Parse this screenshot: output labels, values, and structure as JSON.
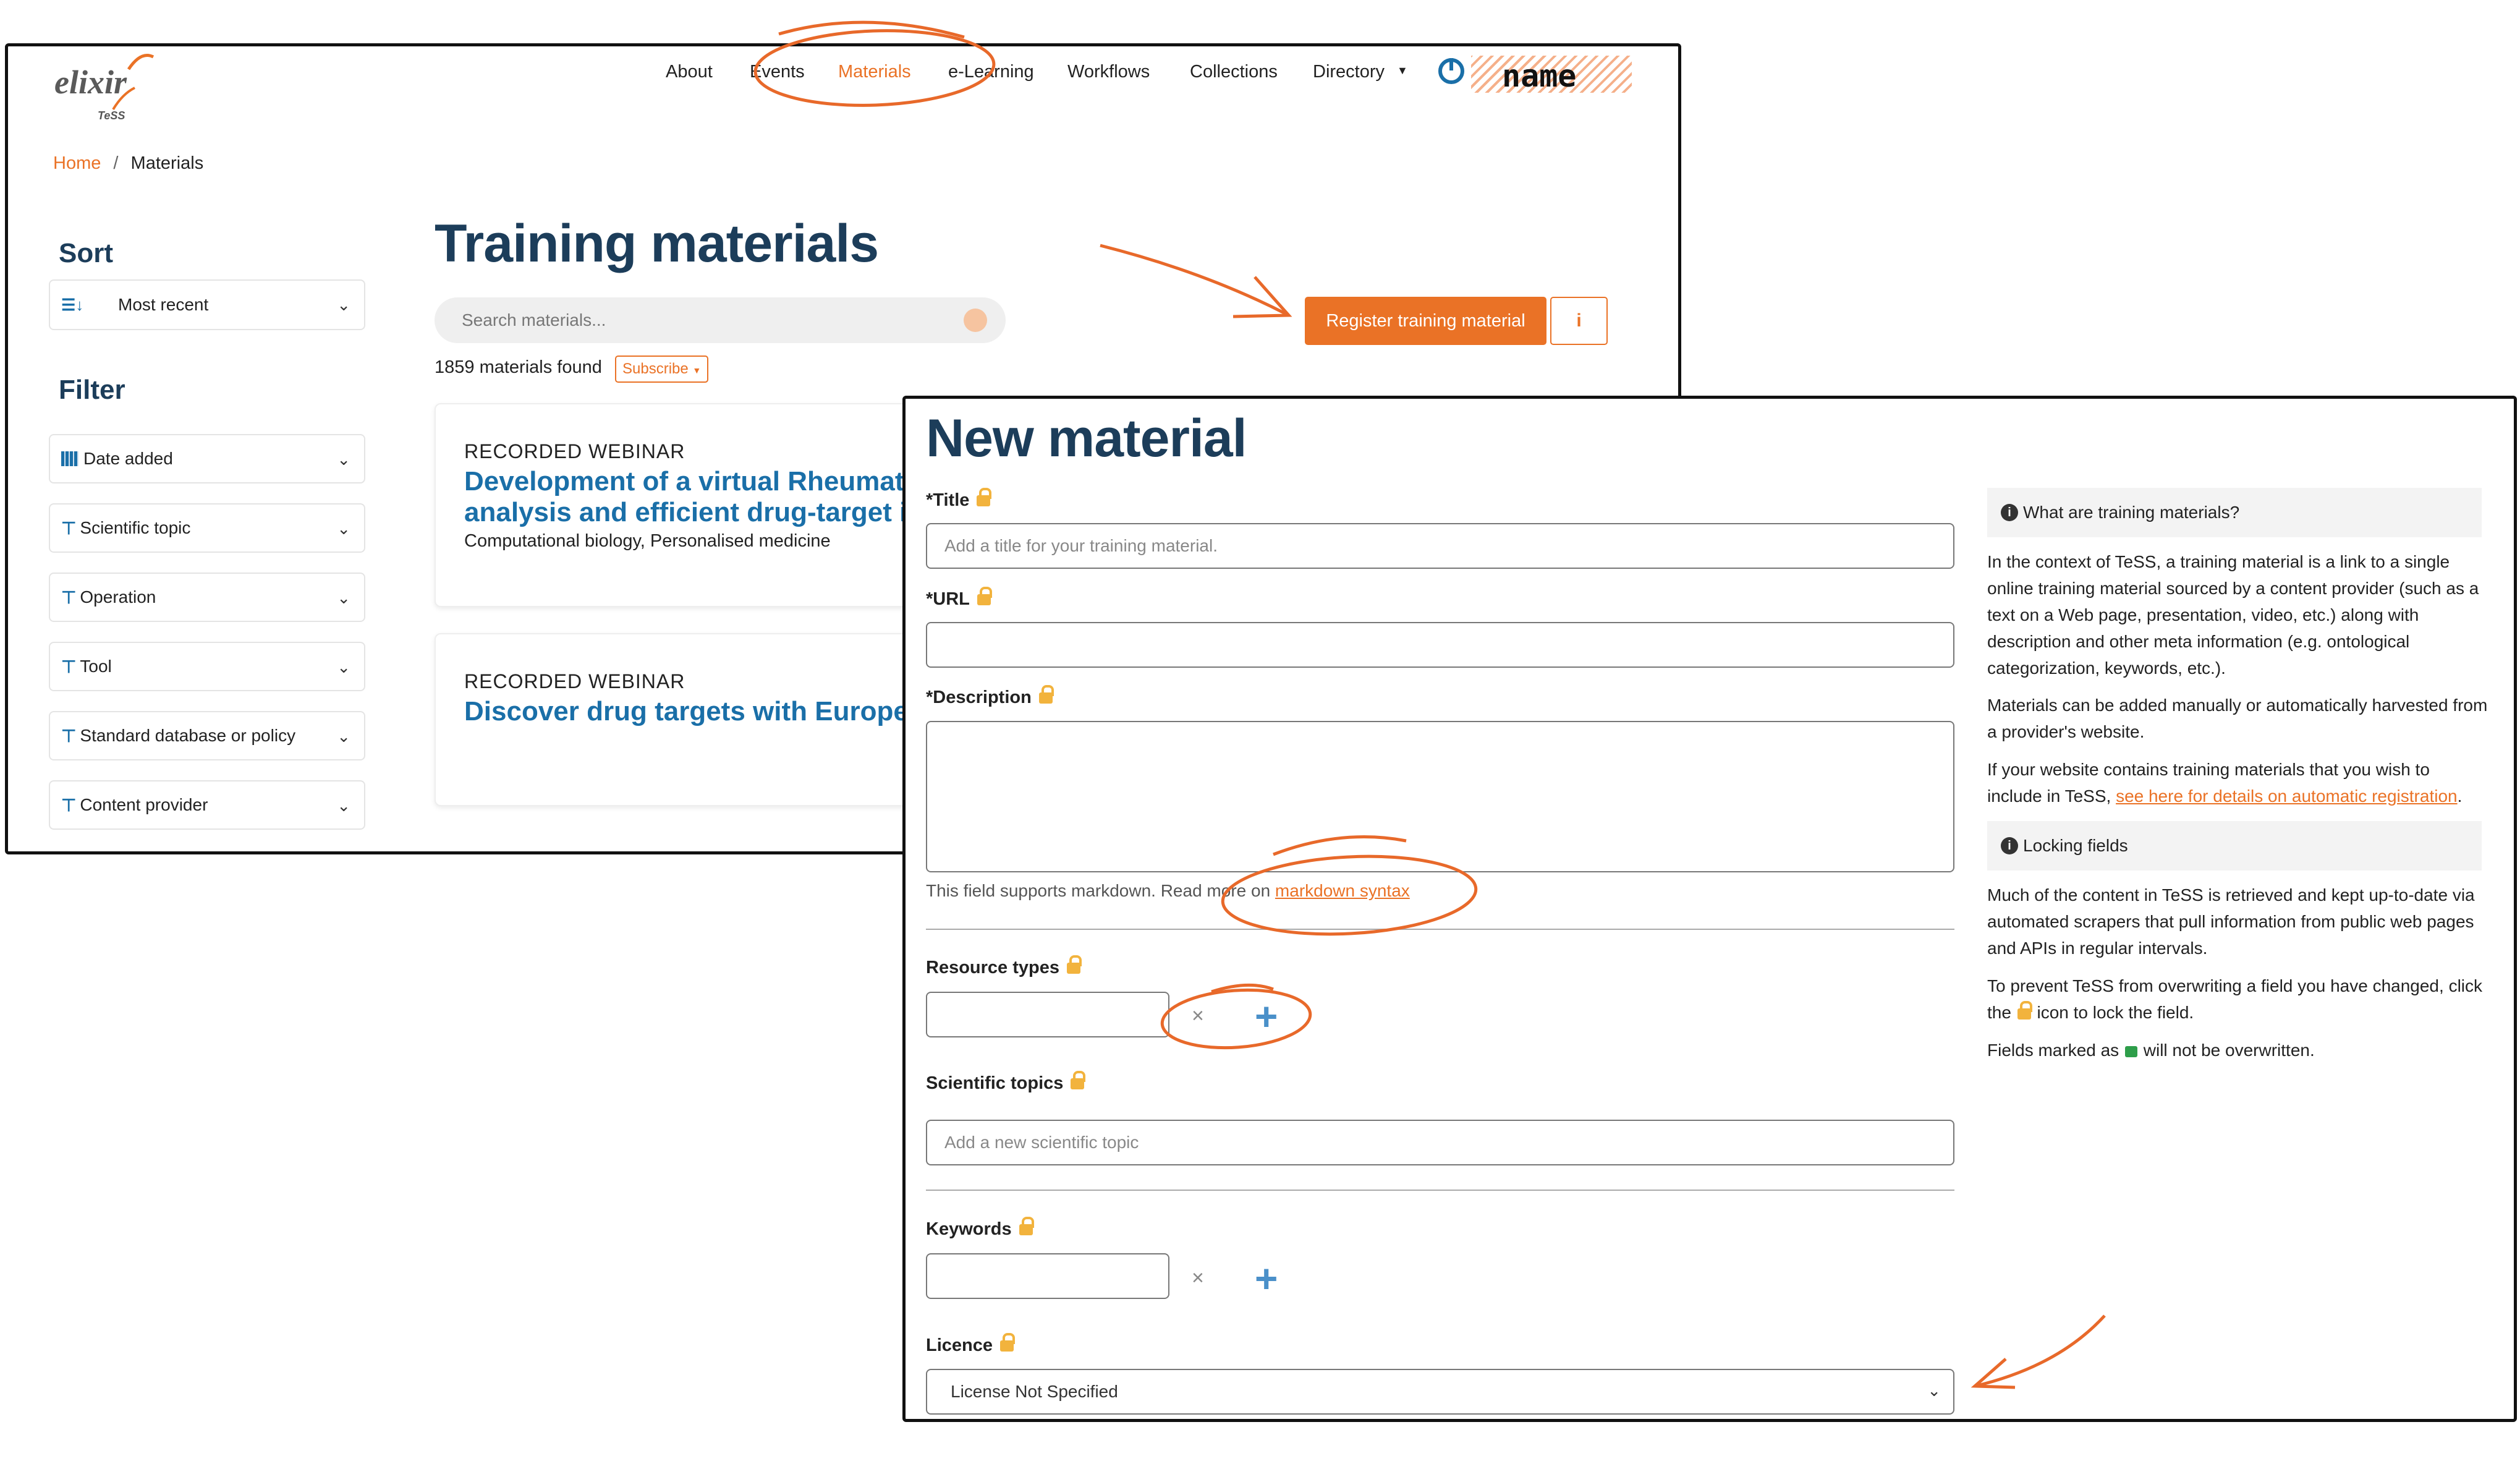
{
  "logo": {
    "text": "elixir",
    "sub": "TeSS"
  },
  "nav": {
    "items": [
      "About",
      "Events",
      "Materials",
      "e-Learning",
      "Workflows",
      "Collections",
      "Directory"
    ],
    "active": "Materials",
    "user": "name"
  },
  "breadcrumb": {
    "home": "Home",
    "separator": "/",
    "current": "Materials"
  },
  "sidebar": {
    "sort_heading": "Sort",
    "sort_value": "Most recent",
    "filter_heading": "Filter",
    "filters": [
      "Date added",
      "Scientific topic",
      "Operation",
      "Tool",
      "Standard database or policy",
      "Content provider"
    ]
  },
  "main": {
    "title": "Training materials",
    "search_placeholder": "Search materials...",
    "count_text": "1859 materials found",
    "subscribe": "Subscribe",
    "register_button": "Register training material",
    "info_button": "i",
    "results": [
      {
        "type": "RECORDED WEBINAR",
        "title_line1": "Development of a virtual Rheumatoid",
        "title_line2": "analysis and efficient drug-target ide",
        "topics": "Computational biology, Personalised medicine"
      },
      {
        "type": "RECORDED WEBINAR",
        "title_line1": "Discover drug targets with Europe PM",
        "title_line2": "",
        "topics": ""
      }
    ]
  },
  "form": {
    "title": "New material",
    "required_mark": "*",
    "title_label": "Title",
    "title_placeholder": "Add a title for your training material.",
    "url_label": "URL",
    "description_label": "Description",
    "markdown_prefix": "This field supports markdown. Read more on ",
    "markdown_link": "markdown syntax",
    "resource_types_label": "Resource types",
    "scientific_topics_label": "Scientific topics",
    "scientific_topics_placeholder": "Add a new scientific topic",
    "keywords_label": "Keywords",
    "licence_label": "Licence",
    "licence_value": "License Not Specified",
    "remove_symbol": "×",
    "add_symbol": "+"
  },
  "help": {
    "what_heading": "What are training materials?",
    "what_p1": "In the context of TeSS, a training material is a link to a single online training material sourced by a content provider (such as a text on a Web page, presentation, video, etc.) along with description and other meta information (e.g. ontological categorization, keywords, etc.).",
    "what_p2": "Materials can be added manually or automatically harvested from a provider's website.",
    "what_p3_prefix": "If your website contains training materials that you wish to include in TeSS, ",
    "what_p3_link": "see here for details on automatic registration",
    "what_p3_suffix": ".",
    "lock_heading": "Locking fields",
    "lock_p1": "Much of the content in TeSS is retrieved and kept up-to-date via automated scrapers that pull information from public web pages and APIs in regular intervals.",
    "lock_p2_a": "To prevent TeSS from overwriting a field you have changed, click the ",
    "lock_p2_b": " icon to lock the field.",
    "lock_p3_a": "Fields marked as ",
    "lock_p3_b": " will not be overwritten."
  },
  "colors": {
    "accent": "#ea7226",
    "link": "#1a6fa8",
    "heading": "#1c3d5a",
    "annotation": "#e8692a"
  }
}
